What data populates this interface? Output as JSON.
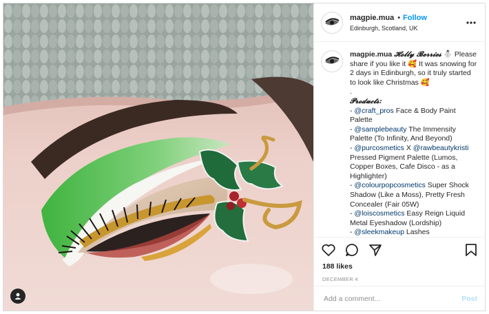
{
  "post": {
    "username": "magpie.mua",
    "follow_label": "Follow",
    "separator": "•",
    "location": "Edinburgh, Scotland, UK",
    "photo_alt": "Festive holly berry eye makeup look"
  },
  "caption": {
    "username": "magpie.mua",
    "title": "𝓗𝓸𝓵𝓵𝔂 𝓑𝓮𝓻𝓻𝓲𝓮𝓼",
    "snowman": "⛄",
    "intro": "Please share if you like it 🥰 It was snowing for 2 days in Edinburgh, so it truly started to look like Christmas 🥰",
    "dot": ".",
    "products_heading": "𝓟𝓻𝓸𝓭𝓾𝓬𝓽𝓼:",
    "products": [
      {
        "prefix": "- ",
        "tag": "@craft_pros",
        "tag2": "",
        "mid": "",
        "text": " Face & Body Paint Palette"
      },
      {
        "prefix": "- ",
        "tag": "@samplebeauty",
        "tag2": "",
        "mid": "",
        "text": " The Immensity Palette (To Infinity, And Beyond)"
      },
      {
        "prefix": "- ",
        "tag": "@purcosmetics",
        "tag2": "@rawbeautykristi",
        "mid": " X ",
        "text": " Pressed Pigment Palette (Lumos, Copper Boxes, Cafe Disco - as a Highlighter)"
      },
      {
        "prefix": "- ",
        "tag": "@colourpopcosmetics",
        "tag2": "",
        "mid": "",
        "text": " Super Shock Shadow (Like a Moss), Pretty Fresh Concealer (Fair 05W)"
      },
      {
        "prefix": "- ",
        "tag": "@loiscosmetics",
        "tag2": "",
        "mid": "",
        "text": " Easy Reign Liquid Metal Eyeshadow (Lordship)"
      },
      {
        "prefix": "- ",
        "tag": "@sleekmakeup",
        "tag2": "",
        "mid": "",
        "text": " Lashes"
      }
    ]
  },
  "stats": {
    "likes": "188 likes",
    "date": "DECEMBER 4"
  },
  "comment": {
    "placeholder": "Add a comment...",
    "post_label": "Post"
  },
  "colors": {
    "link": "#0095f6",
    "tag": "#00376b",
    "muted": "#8e8e8e",
    "post_disabled": "#b2dffc"
  },
  "icons": {
    "more": "more-options-icon",
    "like": "heart-icon",
    "comment": "comment-icon",
    "share": "share-icon",
    "save": "bookmark-icon",
    "user_tag": "user-tag-icon"
  }
}
